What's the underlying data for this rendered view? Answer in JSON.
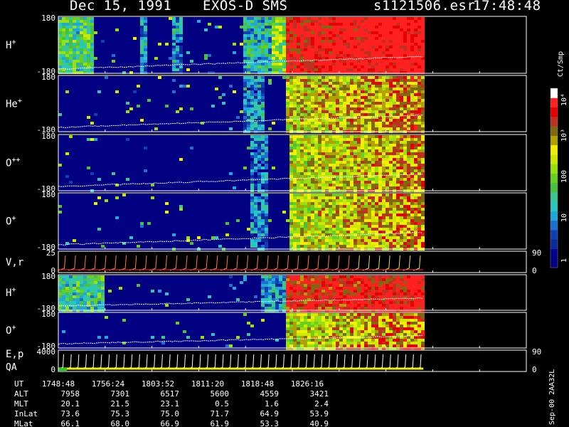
{
  "header": {
    "date": "Dec 15, 1991",
    "instrument": "EXOS-D SMS",
    "file": "s1121506.esr",
    "time": "17:48:48"
  },
  "side_label": "Sep-00 2AA32L",
  "colorbar": {
    "unit_label": "Ct/Smp",
    "tick_labels": [
      "10⁴",
      "10³",
      "100",
      "10",
      "1"
    ],
    "colors": [
      "#000080",
      "#00008a",
      "#0a2a9a",
      "#1040b0",
      "#1a6fd0",
      "#20a8d8",
      "#28c8c0",
      "#38c890",
      "#48c040",
      "#68d020",
      "#98e010",
      "#d0e800",
      "#f0f000",
      "#b0a000",
      "#806810",
      "#c03020",
      "#e80000",
      "#ff2020",
      "#ffffff"
    ]
  },
  "chart_data": {
    "type": "heatmap",
    "data_end_fraction": 0.78,
    "panels": [
      {
        "label": "H",
        "sup": "+",
        "ytop": "180",
        "ybot": "-180",
        "right_top": "",
        "right_bot": ""
      },
      {
        "label": "He",
        "sup": "+",
        "ytop": "180",
        "ybot": "-180",
        "right_top": "",
        "right_bot": ""
      },
      {
        "label": "O",
        "sup": "++",
        "ytop": "180",
        "ybot": "-180",
        "right_top": "",
        "right_bot": ""
      },
      {
        "label": "O",
        "sup": "+",
        "ytop": "180",
        "ybot": "-180",
        "right_top": "",
        "right_bot": ""
      },
      {
        "label": "V,r",
        "sup": "",
        "ytop": "25",
        "ybot": "0",
        "right_top": "90",
        "right_bot": "0"
      },
      {
        "label": "H",
        "sup": "+",
        "ytop": "180",
        "ybot": "-180",
        "right_top": "",
        "right_bot": ""
      },
      {
        "label": "O",
        "sup": "+",
        "ytop": "180",
        "ybot": "-180",
        "right_top": "",
        "right_bot": ""
      },
      {
        "label": "E,p",
        "label2": "QA",
        "sup": "",
        "ytop": "4000",
        "ybot": "0",
        "right_top": "90",
        "right_bot": "0"
      }
    ],
    "table": {
      "row_labels": [
        "UT",
        "ALT",
        "MLT",
        "InLat",
        "MLat"
      ],
      "columns": [
        [
          "1748:48",
          "7958",
          "20.1",
          "73.6",
          "66.1"
        ],
        [
          "1756:24",
          "7301",
          "21.5",
          "75.3",
          "68.0"
        ],
        [
          "1803:52",
          "6517",
          "23.1",
          "75.0",
          "66.9"
        ],
        [
          "1811:20",
          "5600",
          "0.5",
          "71.7",
          "61.9"
        ],
        [
          "1818:48",
          "4559",
          "1.6",
          "64.9",
          "53.3"
        ],
        [
          "1826:16",
          "3421",
          "2.4",
          "53.9",
          "40.9"
        ]
      ]
    }
  }
}
